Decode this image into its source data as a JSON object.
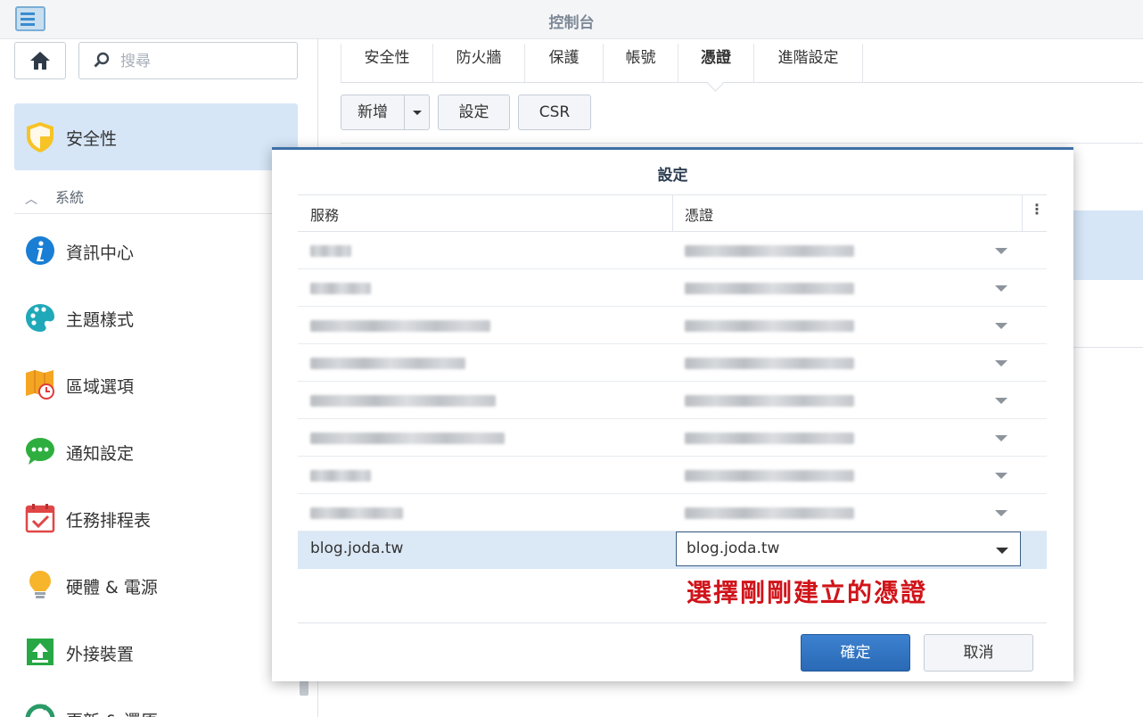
{
  "window": {
    "title": "控制台"
  },
  "sidebar": {
    "search_placeholder": "搜尋",
    "active_item": "安全性",
    "section_label": "系統",
    "items": [
      {
        "label": "資訊中心",
        "icon": "info-icon"
      },
      {
        "label": "主題樣式",
        "icon": "palette-icon"
      },
      {
        "label": "區域選項",
        "icon": "map-clock-icon"
      },
      {
        "label": "通知設定",
        "icon": "chat-bubble-icon"
      },
      {
        "label": "任務排程表",
        "icon": "calendar-check-icon"
      },
      {
        "label": "硬體 & 電源",
        "icon": "lightbulb-icon"
      },
      {
        "label": "外接裝置",
        "icon": "upload-device-icon"
      },
      {
        "label": "更新 & 還原",
        "icon": "refresh-icon"
      }
    ]
  },
  "tabs": [
    "安全性",
    "防火牆",
    "保護",
    "帳號",
    "憑證",
    "進階設定"
  ],
  "active_tab": "憑證",
  "toolbar": {
    "add": "新增",
    "settings": "設定",
    "csr": "CSR"
  },
  "dialog": {
    "title": "設定",
    "col_service": "服務",
    "col_certificate": "憑證",
    "selected_row": {
      "service": "blog.joda.tw",
      "certificate": "blog.joda.tw"
    },
    "annotation": "選擇剛剛建立的憑證",
    "ok": "確定",
    "cancel": "取消"
  },
  "colors": {
    "accent": "#2a69b5",
    "selected_bg": "#d6e6f7",
    "annotation": "#d0141a"
  }
}
